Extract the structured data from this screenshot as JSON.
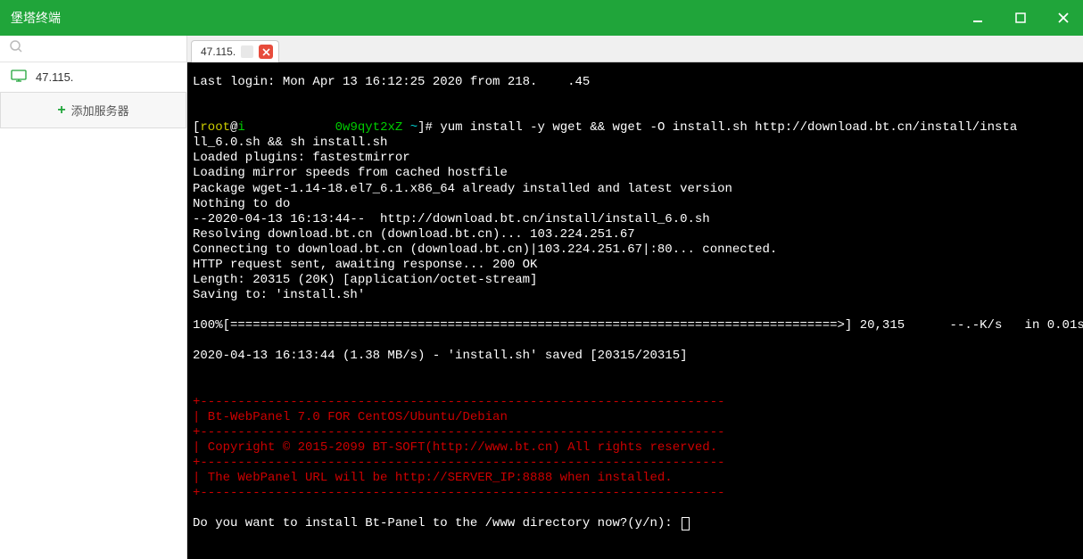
{
  "window": {
    "title": "堡塔终端"
  },
  "sidebar": {
    "search_placeholder": "",
    "servers": [
      {
        "ip_prefix": "47.115.",
        "ip_mask": "   "
      }
    ],
    "add_label": "添加服务器"
  },
  "tabs": [
    {
      "label_prefix": "47.115.",
      "label_mask": "   "
    }
  ],
  "terminal": {
    "last_login_pre": "Last login: Mon Apr 13 16:12:25 2020 from 218.",
    "last_login_mask": "    ",
    "last_login_post": ".45",
    "prompt_user": "root",
    "prompt_host_pre": "i",
    "prompt_host_mask": "            ",
    "prompt_host_post": "0w9qyt2xZ",
    "prompt_path": "~",
    "cmd": "yum install -y wget && wget -O install.sh http://download.bt.cn/install/insta",
    "line2": "ll_6.0.sh && sh install.sh",
    "line3": "Loaded plugins: fastestmirror",
    "line4": "Loading mirror speeds from cached hostfile",
    "line5": "Package wget-1.14-18.el7_6.1.x86_64 already installed and latest version",
    "line6": "Nothing to do",
    "line7": "--2020-04-13 16:13:44--  http://download.bt.cn/install/install_6.0.sh",
    "line8": "Resolving download.bt.cn (download.bt.cn)... 103.224.251.67",
    "line9": "Connecting to download.bt.cn (download.bt.cn)|103.224.251.67|:80... connected.",
    "line10": "HTTP request sent, awaiting response... 200 OK",
    "line11": "Length: 20315 (20K) [application/octet-stream]",
    "line12": "Saving to: 'install.sh'",
    "progress": "100%[=================================================================================>] 20,315      --.-K/s   in 0.01s",
    "saved": "2020-04-13 16:13:44 (1.38 MB/s) - 'install.sh' saved [20315/20315]",
    "sep": "+----------------------------------------------------------------------",
    "banner1": "| Bt-WebPanel 7.0 FOR CentOS/Ubuntu/Debian",
    "banner2": "| Copyright © 2015-2099 BT-SOFT(http://www.bt.cn) All rights reserved.",
    "banner3": "| The WebPanel URL will be http://SERVER_IP:8888 when installed.",
    "prompt_q": "Do you want to install Bt-Panel to the /www directory now?(y/n): "
  }
}
